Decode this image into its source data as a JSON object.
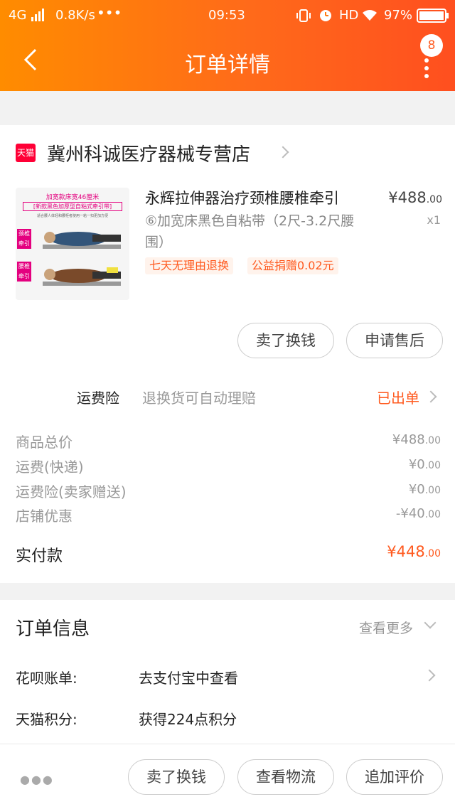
{
  "status": {
    "network": "4G",
    "speed": "0.8K/s",
    "time": "09:53",
    "hd": "HD",
    "battery": "97%"
  },
  "nav": {
    "title": "订单详情",
    "badge": "8"
  },
  "shop": {
    "icon_text": "天猫",
    "name": "冀州科诚医疗器械专营店"
  },
  "product": {
    "name": "永辉拉伸器治疗颈椎腰椎牵引",
    "spec": "⑥加宽床黑色自粘带（2尺-3.2尺腰围）",
    "price_symbol": "¥",
    "price_int": "488",
    "price_dec": ".00",
    "qty": "x1",
    "tags": [
      "七天无理由退换",
      "公益捐赠0.02元"
    ],
    "thumb_text": [
      "加宽款床宽46厘米",
      "[新款黑色加厚型自粘式牵引带]",
      "适合腰人体轻和腰柜者使用一粘一扣更加方便",
      "颈椎牵引",
      "腰椎牵引"
    ]
  },
  "item_buttons": [
    "卖了换钱",
    "申请售后"
  ],
  "insurance": {
    "label": "运费险",
    "desc": "退换货可自动理赔",
    "status": "已出单"
  },
  "costs": [
    {
      "label": "商品总价",
      "sym": "¥",
      "int": "488",
      "dec": ".00"
    },
    {
      "label": "运费(快递)",
      "sym": "¥",
      "int": "0",
      "dec": ".00"
    },
    {
      "label": "运费险(卖家赠送)",
      "sym": "¥",
      "int": "0",
      "dec": ".00"
    },
    {
      "label": "店铺优惠",
      "sym": "-¥",
      "int": "40",
      "dec": ".00"
    }
  ],
  "paid": {
    "label": "实付款",
    "sym": "¥",
    "int": "448",
    "dec": ".00"
  },
  "order_info": {
    "title": "订单信息",
    "more": "查看更多",
    "rows": [
      {
        "label": "花呗账单:",
        "value": "去支付宝中查看"
      },
      {
        "label": "天猫积分:",
        "value": "获得224点积分"
      }
    ]
  },
  "bottom_buttons": [
    "卖了换钱",
    "查看物流",
    "追加评价"
  ],
  "colors": {
    "accent": "#ff5a1f",
    "header_start": "#ff8c00",
    "header_end": "#ff4f1f",
    "tmall_red": "#ff0036"
  }
}
